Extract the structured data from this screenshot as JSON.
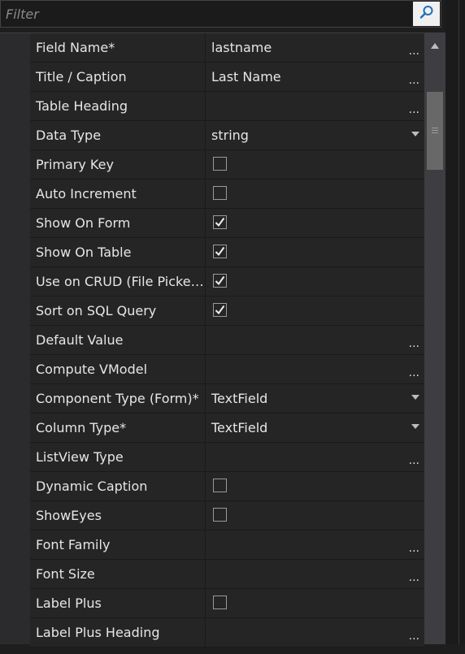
{
  "filter": {
    "placeholder": "Filter",
    "value": ""
  },
  "icons": {
    "search": "search-icon",
    "scroll_up": "chevron-up-icon",
    "dropdown": "chevron-down-icon",
    "checkmark": "check-icon"
  },
  "colors": {
    "background": "#1e1e1e",
    "row": "#252526",
    "text": "#e6e6e6",
    "search_button": "#f0f0f0",
    "search_icon": "#1e6fb5"
  },
  "properties": [
    {
      "name": "Field Name*",
      "value": "lastname",
      "editor": "text-ellipsis"
    },
    {
      "name": "Title / Caption",
      "value": "Last Name",
      "editor": "text-ellipsis"
    },
    {
      "name": "Table Heading",
      "value": "",
      "editor": "text-ellipsis"
    },
    {
      "name": "Data Type",
      "value": "string",
      "editor": "dropdown"
    },
    {
      "name": "Primary Key",
      "checked": false,
      "editor": "checkbox"
    },
    {
      "name": "Auto Increment",
      "checked": false,
      "editor": "checkbox"
    },
    {
      "name": "Show On Form",
      "checked": true,
      "editor": "checkbox"
    },
    {
      "name": "Show On Table",
      "checked": true,
      "editor": "checkbox"
    },
    {
      "name": "Use on CRUD (File Picker...",
      "checked": true,
      "editor": "checkbox"
    },
    {
      "name": "Sort on SQL Query",
      "checked": true,
      "editor": "checkbox"
    },
    {
      "name": "Default Value",
      "value": "",
      "editor": "text-ellipsis"
    },
    {
      "name": "Compute VModel",
      "value": "",
      "editor": "text-ellipsis"
    },
    {
      "name": "Component Type (Form)*",
      "value": "TextField",
      "editor": "dropdown"
    },
    {
      "name": "Column Type*",
      "value": "TextField",
      "editor": "dropdown"
    },
    {
      "name": "ListView Type",
      "value": "",
      "editor": "text-ellipsis"
    },
    {
      "name": "Dynamic Caption",
      "checked": false,
      "editor": "checkbox"
    },
    {
      "name": "ShowEyes",
      "checked": false,
      "editor": "checkbox"
    },
    {
      "name": "Font Family",
      "value": "",
      "editor": "text-ellipsis"
    },
    {
      "name": "Font Size",
      "value": "",
      "editor": "text-ellipsis"
    },
    {
      "name": "Label Plus",
      "checked": false,
      "editor": "checkbox"
    },
    {
      "name": "Label Plus Heading",
      "value": "",
      "editor": "text-ellipsis"
    }
  ],
  "ellipsis_label": "..."
}
